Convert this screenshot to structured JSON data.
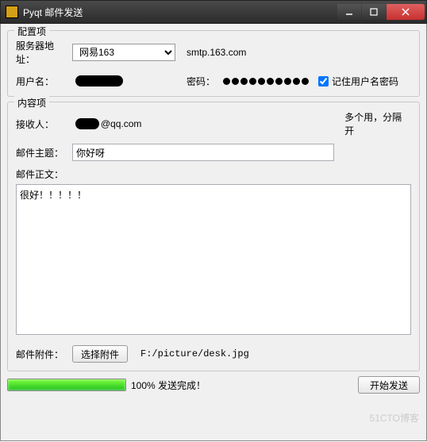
{
  "window": {
    "title": "Pyqt 邮件发送"
  },
  "config": {
    "group_title": "配置项",
    "server_label": "服务器地址：",
    "server_selected": "网易163",
    "smtp": "smtp.163.com",
    "user_label": "用户名：",
    "user_value": "",
    "pwd_label": "密码：",
    "pwd_value": "●●●●●●●●●●",
    "remember_label": "记住用户名密码",
    "remember_checked": true
  },
  "content": {
    "group_title": "内容项",
    "to_label": "接收人：",
    "to_value": "@qq.com",
    "to_hint": "多个用，分隔开",
    "subject_label": "邮件主题：",
    "subject_value": "你好呀",
    "body_label": "邮件正文：",
    "body_value": "很好！！！！！",
    "attach_label": "邮件附件：",
    "attach_btn": "选择附件",
    "attach_path": "F:/picture/desk.jpg"
  },
  "bottom": {
    "progress_pct": 100,
    "progress_text": "100%  发送完成！",
    "send_btn": "开始发送"
  },
  "watermark": "51CTO博客"
}
